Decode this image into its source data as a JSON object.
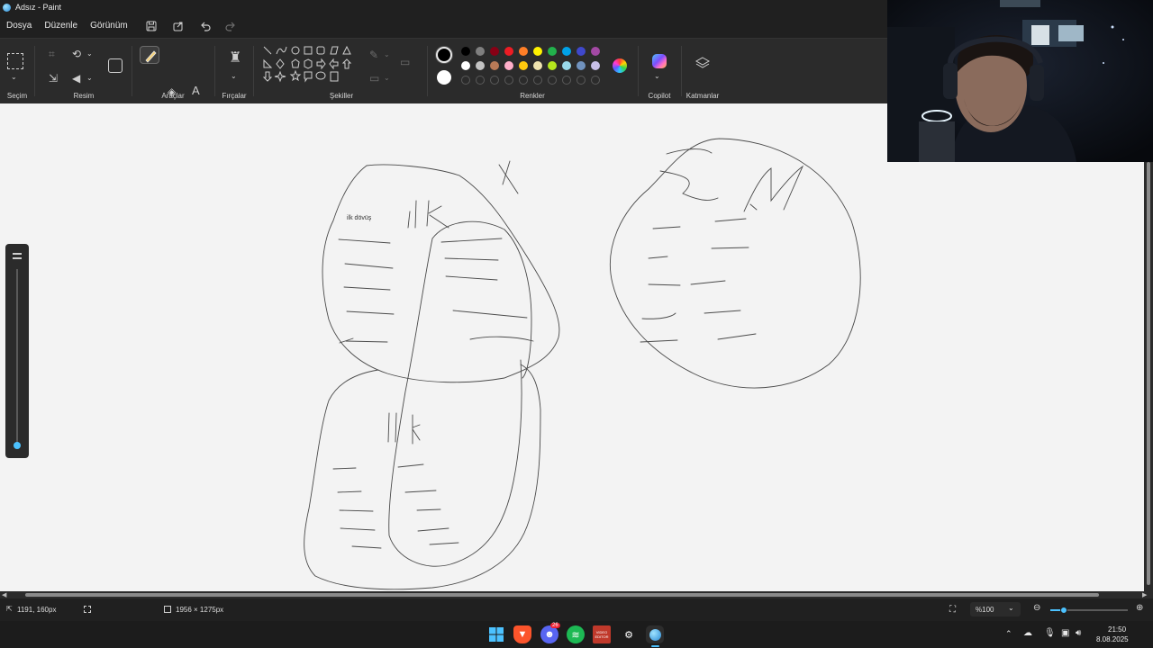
{
  "window": {
    "title": "Adsız - Paint"
  },
  "menu": {
    "file": "Dosya",
    "edit": "Düzenle",
    "view": "Görünüm"
  },
  "ribbon": {
    "selection_label": "Seçim",
    "image_label": "Resim",
    "tools_label": "Araçlar",
    "brushes_label": "Fırçalar",
    "shapes_label": "Şekiller",
    "colors_label": "Renkler",
    "copilot_label": "Copilot",
    "layers_label": "Katmanlar",
    "text_tool_glyph": "A"
  },
  "palette": {
    "primary": "#000000",
    "secondary": "#ffffff",
    "row1": [
      "#000000",
      "#7f7f7f",
      "#880015",
      "#ed1c24",
      "#ff7f27",
      "#fff200",
      "#22b14c",
      "#00a2e8",
      "#3f48cc",
      "#a349a4"
    ],
    "row2": [
      "#ffffff",
      "#c3c3c3",
      "#b97a57",
      "#ffaec9",
      "#ffc90e",
      "#efe4b0",
      "#b5e61d",
      "#99d9ea",
      "#7092be",
      "#c8bfe7"
    ]
  },
  "canvas": {
    "note_text": "ilk dövüş",
    "handwriting_top": "İlk",
    "handwriting_bottom": "İlk",
    "handwriting_x": "X"
  },
  "status": {
    "cursor_position": "1191, 160px",
    "canvas_size": "1956 × 1275px",
    "zoom_level": "%100"
  },
  "taskbar": {
    "time": "21:50",
    "date": "8.08.2025",
    "discord_badge": "26",
    "video_app_label": "VIDEO EDITOR"
  }
}
